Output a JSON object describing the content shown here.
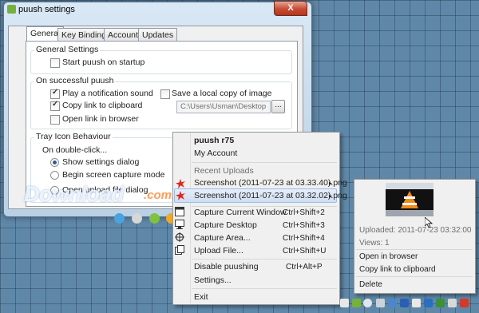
{
  "window": {
    "title": "puush settings",
    "close_label": "X",
    "tabs": [
      {
        "label": "General",
        "active": true
      },
      {
        "label": "Key Bindings"
      },
      {
        "label": "Account"
      },
      {
        "label": "Updates"
      }
    ]
  },
  "general_settings": {
    "heading": "General Settings",
    "start_on_startup": {
      "label": "Start puush on startup",
      "checked": false
    }
  },
  "on_successful": {
    "heading": "On successful puush",
    "play_sound": {
      "label": "Play a notification sound",
      "checked": true
    },
    "copy_link": {
      "label": "Copy link to clipboard",
      "checked": true
    },
    "open_link": {
      "label": "Open link in browser",
      "checked": false
    },
    "save_local": {
      "label": "Save a local copy of image",
      "checked": false
    },
    "path_value": "C:\\Users\\Usman\\Desktop",
    "browse_label": "..."
  },
  "tray_behaviour": {
    "heading": "Tray Icon Behaviour",
    "subheading": "On double-click...",
    "options": [
      {
        "label": "Show settings dialog",
        "selected": true
      },
      {
        "label": "Begin screen capture mode",
        "selected": false
      },
      {
        "label": "Open upload file dialog",
        "selected": false
      }
    ]
  },
  "context_menu": {
    "version": "puush r75",
    "my_account": "My Account",
    "recent_uploads_heading": "Recent Uploads",
    "recent": [
      "Screenshot (2011-07-23 at 03.33.40).png",
      "Screenshot (2011-07-23 at 03.32.02).png"
    ],
    "arrow": "▸",
    "actions": [
      {
        "label": "Capture Current Window",
        "shortcut": "Ctrl+Shift+2",
        "icon": "window-capture-icon"
      },
      {
        "label": "Capture Desktop",
        "shortcut": "Ctrl+Shift+3",
        "icon": "desktop-icon"
      },
      {
        "label": "Capture Area...",
        "shortcut": "Ctrl+Shift+4",
        "icon": "crosshair-icon"
      },
      {
        "label": "Upload File...",
        "shortcut": "Ctrl+Shift+U",
        "icon": "upload-file-icon"
      }
    ],
    "disable": {
      "label": "Disable puushing",
      "shortcut": "Ctrl+Alt+P"
    },
    "settings": "Settings...",
    "exit": "Exit"
  },
  "preview": {
    "uploaded": "Uploaded: 2011-07-23 03:32:00",
    "views": "Views: 1",
    "open_browser": "Open in browser",
    "copy_link": "Copy link to clipboard",
    "delete": "Delete"
  },
  "watermark": {
    "text": "Download",
    "suffix": ".com.vn"
  },
  "colors": {
    "desktop": "#5f88a8",
    "menu_highlight": "#cfdef2",
    "close_button": "#c74a32",
    "puush_green": "#76b13d"
  }
}
